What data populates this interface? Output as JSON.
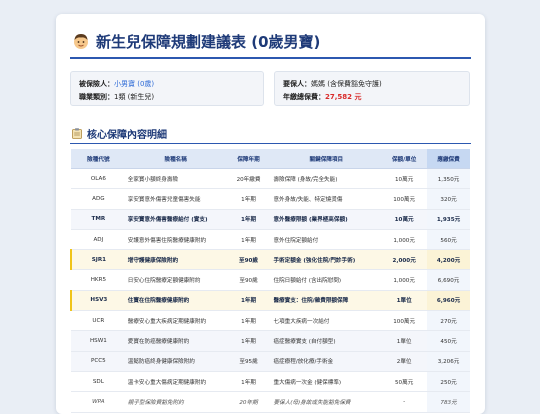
{
  "header": {
    "title": "新生兒保障規劃建議表 (0歲男寶)"
  },
  "info": {
    "insured_label": "被保險人：",
    "insured_value": "小男寶 (0歲)",
    "occupation_label": "職業類別：",
    "occupation_value": "1類 (新生兒)",
    "policyholder_label": "要保人：",
    "policyholder_value": "媽媽 (含保費豁免守護)",
    "annual_premium_label": "年繳總保費：",
    "annual_premium_value": "27,582 元"
  },
  "section": {
    "title": "核心保障內容明細"
  },
  "table": {
    "columns": [
      "險種代號",
      "險種名稱",
      "保障年期",
      "關鍵保障項目",
      "保額/單位",
      "應繳保費"
    ],
    "rows": [
      {
        "code": "OLA6",
        "name": "全家寶小額終身壽險",
        "term": "20年繳費",
        "item": "壽險保障 (身故/完全失能)",
        "amount": "10萬元",
        "premium": "1,350元",
        "style": ""
      },
      {
        "code": "ADG",
        "name": "享安寶意外傷害兒童傷害失能",
        "term": "1年期",
        "item": "意外身故/失能、特定燒燙傷",
        "amount": "100萬元",
        "premium": "320元",
        "style": ""
      },
      {
        "code": "TMR",
        "name": "享安寶意外傷害醫療給付 (實支)",
        "term": "1年期",
        "item": "意外醫療限額 (業界極高保額)",
        "amount": "10萬元",
        "premium": "1,935元",
        "style": "bold tint"
      },
      {
        "code": "ADJ",
        "name": "安護意外傷害住院醫療健康附約",
        "term": "1年期",
        "item": "意外住院定額給付",
        "amount": "1,000元",
        "premium": "560元",
        "style": ""
      },
      {
        "code": "SJR1",
        "name": "增守護健康保險附約",
        "term": "至90歲",
        "item": "手術定額金 (強化住院/門診手術)",
        "amount": "2,000元",
        "premium": "4,200元",
        "style": "bold em"
      },
      {
        "code": "HKR5",
        "name": "日安心住院醫療定額健康附約",
        "term": "至90歲",
        "item": "住院日額給付 (含出院慰問)",
        "amount": "1,000元",
        "premium": "6,690元",
        "style": ""
      },
      {
        "code": "HSV3",
        "name": "住寶在住院醫療健康附約",
        "term": "1年期",
        "item": "醫療實支：住院/雜費限額保障",
        "amount": "1單位",
        "premium": "6,960元",
        "style": "bold em"
      },
      {
        "code": "UCR",
        "name": "醫療安心重大疾病定期健康附約",
        "term": "1年期",
        "item": "七項重大疾病一次給付",
        "amount": "100萬元",
        "premium": "270元",
        "style": ""
      },
      {
        "code": "HSW1",
        "name": "愛寶在防癌醫療健康附約",
        "term": "1年期",
        "item": "癌症醫療實支 (自付額型)",
        "amount": "1單位",
        "premium": "450元",
        "style": "tint"
      },
      {
        "code": "PCC5",
        "name": "溫懿防癌終身健康保險附約",
        "term": "至95歲",
        "item": "癌症療程/放化療/手術金",
        "amount": "2單位",
        "premium": "3,206元",
        "style": "tint"
      },
      {
        "code": "SDL",
        "name": "溫卡安心重大傷病定期健康附約",
        "term": "1年期",
        "item": "重大傷病一次金 (健保標準)",
        "amount": "50萬元",
        "premium": "250元",
        "style": ""
      },
      {
        "code": "WPA",
        "name": "親子型保險費豁免附約",
        "term": "20年期",
        "item": "要保人(母)身故或失能豁免保費",
        "amount": "-",
        "premium": "783元",
        "style": "italic"
      }
    ]
  },
  "colors": {
    "title": "#1e3a78",
    "accent_rule": "#2c58b0",
    "blue_value": "#2d6ad6",
    "red_total": "#d92b2b",
    "highlight_row": "#fdf8e6",
    "highlight_border": "#f0c419"
  },
  "icons": {
    "title_icon": "boy-face-icon",
    "section_icon": "clipboard-icon"
  }
}
